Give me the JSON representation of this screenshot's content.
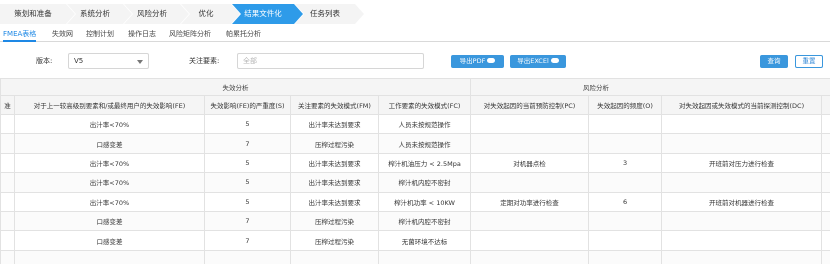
{
  "steps": [
    "策划和准备",
    "系统分析",
    "风险分析",
    "优化",
    "结果文件化",
    "任务列表"
  ],
  "active_step": 4,
  "subtabs": [
    "FMEA表格",
    "失效网",
    "控制计划",
    "操作日志",
    "风险矩阵分析",
    "帕累托分析"
  ],
  "active_subtab": 0,
  "filters": {
    "version_label": "版本:",
    "version_value": "V5",
    "focus_label": "关注要素:",
    "focus_placeholder": "全部",
    "export_pdf": "导出PDF",
    "export_excel": "导出EXCEl",
    "query": "查询",
    "reset": "重置"
  },
  "table": {
    "group_failure": "失效分析",
    "group_risk": "风险分析",
    "columns": [
      "准",
      "对于上一较高级别要素和/或最终用户的失效影响(FE)",
      "失效影响(FE)的严重度(S)",
      "关注要素的失效模式(FM)",
      "工作要素的失效模式(FC)",
      "对失效起因的当前预防控制(PC)",
      "失效起因的频度(O)",
      "对失效起因或失效模式的当前探测控制(DC)",
      ""
    ],
    "rows": [
      [
        "",
        "出汁率<70%",
        "5",
        "出汁率未达到要求",
        "人员未按规范操作",
        "",
        "",
        "",
        ""
      ],
      [
        "",
        "口感变差",
        "7",
        "压榨过程污染",
        "人员未按规范操作",
        "",
        "",
        "",
        ""
      ],
      [
        "",
        "出汁率<70%",
        "5",
        "出汁率未达到要求",
        "榨汁机油压力 < 2.5Mpa",
        "对机器点检",
        "3",
        "开班前对压力进行检查",
        ""
      ],
      [
        "",
        "出汁率<70%",
        "5",
        "出汁率未达到要求",
        "榨汁机内腔不密封",
        "",
        "",
        "",
        ""
      ],
      [
        "",
        "出汁率<70%",
        "5",
        "出汁率未达到要求",
        "榨汁机功率 < 10KW",
        "定期对功率进行检查",
        "6",
        "开班前对机器进行检查",
        ""
      ],
      [
        "",
        "口感变差",
        "7",
        "压榨过程污染",
        "榨汁机内腔不密封",
        "",
        "",
        "",
        ""
      ],
      [
        "",
        "口感变差",
        "7",
        "压榨过程污染",
        "无菌环境不达标",
        "",
        "",
        "",
        ""
      ],
      [
        "",
        "",
        "",
        "",
        "",
        "",
        "",
        "",
        ""
      ]
    ]
  },
  "colors": {
    "active_step": "#2e9be9",
    "active_tab": "#1e88e5",
    "button": "#3a97dd"
  }
}
